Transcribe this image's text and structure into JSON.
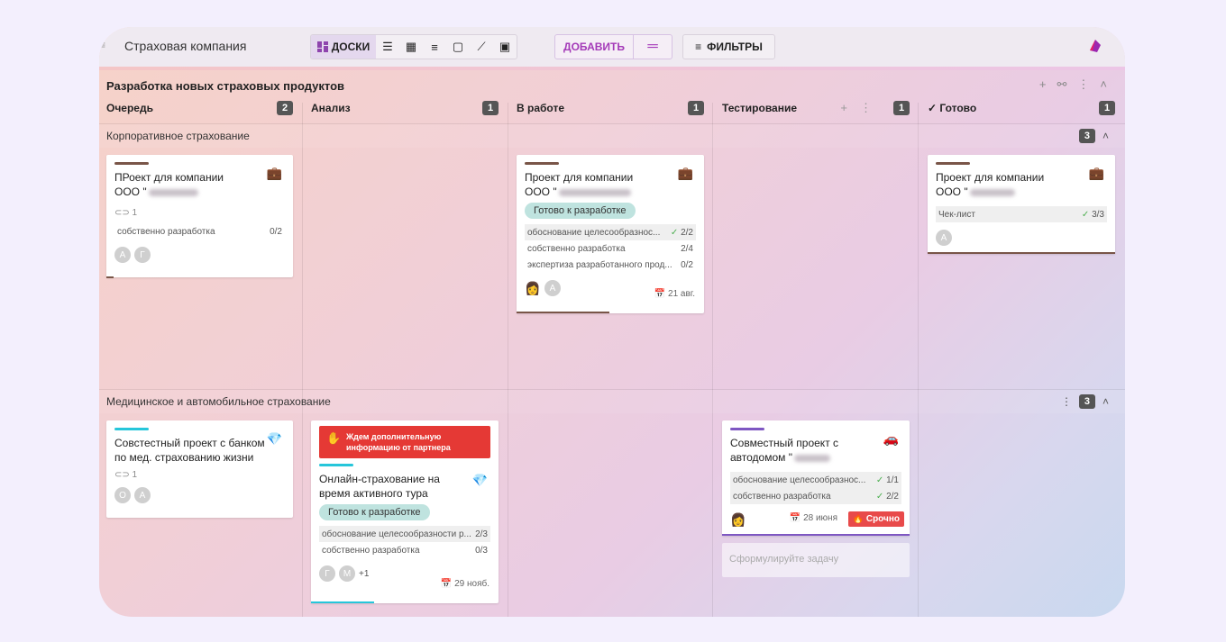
{
  "app": {
    "title": "Страховая компания"
  },
  "toolbar": {
    "boards_label": "ДОСКИ",
    "add_label": "ДОБАВИТЬ",
    "add_more": "═",
    "filters_label": "ФИЛЬТРЫ"
  },
  "board": {
    "title": "Разработка новых страховых продуктов"
  },
  "columns": [
    {
      "name": "Очередь",
      "count": "2"
    },
    {
      "name": "Анализ",
      "count": "1"
    },
    {
      "name": "В работе",
      "count": "1"
    },
    {
      "name": "Тестирование",
      "count": "1"
    },
    {
      "name": "✓ Готово",
      "count": "1"
    }
  ],
  "swimlanes": [
    {
      "name": "Корпоративное страхование",
      "count": "3"
    },
    {
      "name": "Медицинское и автомобильное страхование",
      "count": "3"
    }
  ],
  "cards": {
    "c1": {
      "title": "ПРоект для компании ООО \"",
      "attach": "1",
      "check1_label": "собственно разработка",
      "check1_value": "0/2",
      "av1": "А",
      "av2": "Г",
      "color": "#795548"
    },
    "c2": {
      "title": "Проект для компании ООО \"",
      "tag": "Готово к разработке",
      "check1_label": "обоснование целесообразнос...",
      "check1_value": "2/2",
      "check2_label": "собственно разработка",
      "check2_value": "2/4",
      "check3_label": "экспертиза разработанного прод...",
      "check3_value": "0/2",
      "av1": "А",
      "date": "21 авг.",
      "color": "#795548"
    },
    "c3": {
      "title": "Проект для компании ООО \"",
      "check1_label": "Чек-лист",
      "check1_value": "3/3",
      "av1": "А",
      "color": "#795548"
    },
    "c4": {
      "title": "Совстестный проект с банком по мед. страхованию жизни",
      "attach": "1",
      "av1": "О",
      "av2": "А",
      "color": "#26c6da"
    },
    "c5": {
      "banner": "Ждем дополнительную информацию от партнера",
      "title": "Онлайн-страхование на время активного тура",
      "tag": "Готово к разработке",
      "check1_label": "обоснование целесообразности р...",
      "check1_value": "2/3",
      "check2_label": "собственно разработка",
      "check2_value": "0/3",
      "av1": "Г",
      "av2": "М",
      "more": "+1",
      "date": "29 нояб.",
      "color": "#26c6da"
    },
    "c6": {
      "title": "Совместный проект с автодомом \"",
      "check1_label": "обоснование целесообразнос...",
      "check1_value": "1/1",
      "check2_label": "собственно разработка",
      "check2_value": "2/2",
      "date": "28 июня",
      "urgent": "Срочно",
      "color": "#7e57c2"
    }
  },
  "draft": {
    "placeholder": "Сформулируйте задачу"
  },
  "colors": {
    "accent": "#a43ab8",
    "badge": "#555555",
    "tag": "#bfe3df",
    "urgent": "#e84a4a",
    "banner": "#e53935"
  }
}
